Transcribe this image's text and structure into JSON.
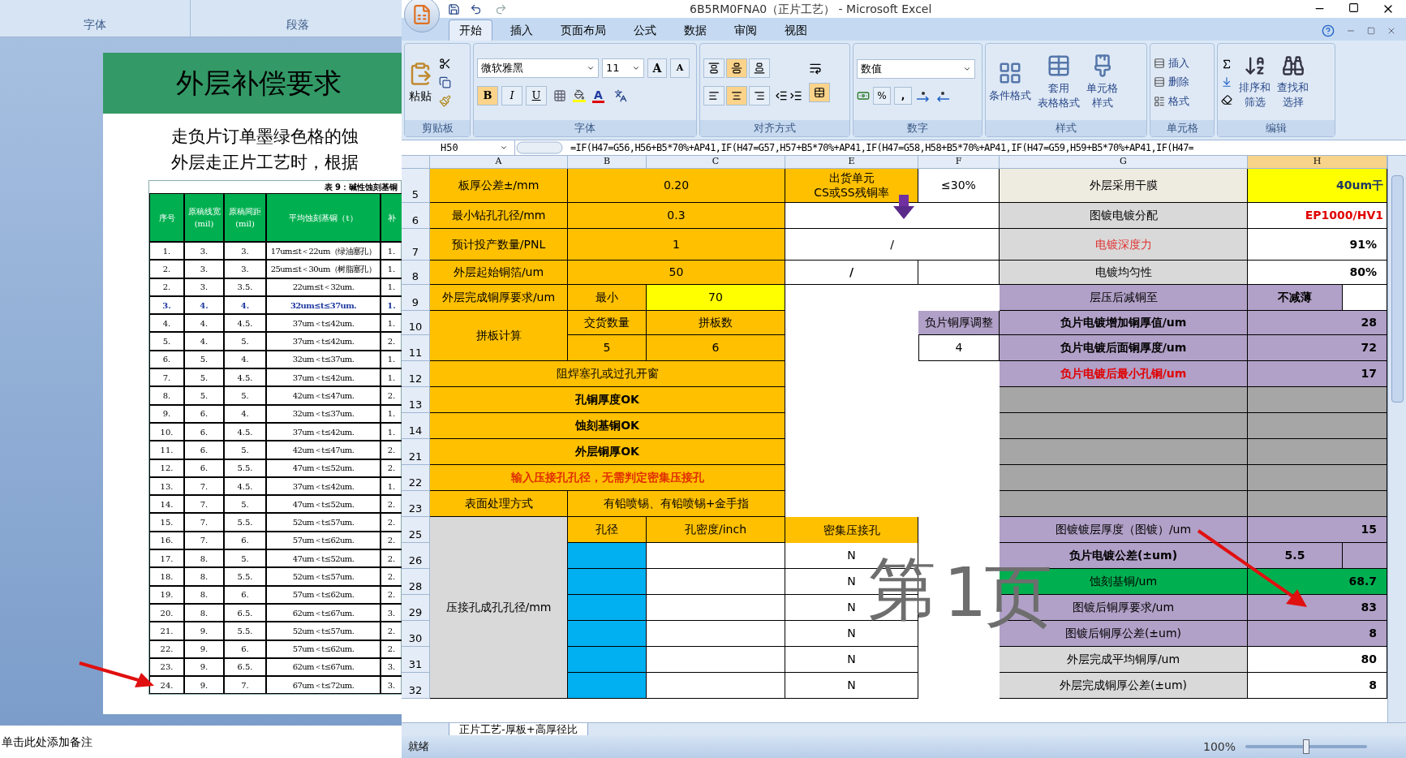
{
  "word": {
    "ribbon_groups": [
      "字体",
      "段落"
    ],
    "slide": {
      "title": "外层补偿要求",
      "lines": [
        "走负片订单墨绿色格的蚀",
        "外层走正片工艺时，根据"
      ],
      "caption": "表 9：碱性蚀刻基铜",
      "columns": [
        "序号",
        "原稿线宽(mil)",
        "原稿间距(mil)",
        "平均蚀刻基铜（t）",
        "补"
      ],
      "rows": [
        {
          "cells": [
            "1.",
            "3.",
            "3.",
            "17um≤t＜22um（绿油塞孔）",
            "1."
          ],
          "highlight": false
        },
        {
          "cells": [
            "2.",
            "3.",
            "3.",
            "25um≤t＜30um（树脂塞孔）",
            "1."
          ],
          "highlight": false
        },
        {
          "cells": [
            "2.",
            "3.",
            "3.5.",
            "22um≤t＜32um.",
            "1."
          ],
          "highlight": false
        },
        {
          "cells": [
            "3.",
            "4.",
            "4.",
            "32um≤t≤37um.",
            "1."
          ],
          "highlight": true
        },
        {
          "cells": [
            "4.",
            "4.",
            "4.5.",
            "37um＜t≤42um.",
            "1."
          ],
          "highlight": false
        },
        {
          "cells": [
            "5.",
            "4.",
            "5.",
            "37um＜t≤42um.",
            "2."
          ],
          "highlight": false
        },
        {
          "cells": [
            "6.",
            "5.",
            "4.",
            "32um＜t≤37um.",
            "1."
          ],
          "highlight": false
        },
        {
          "cells": [
            "7.",
            "5.",
            "4.5.",
            "37um＜t≤42um.",
            "1."
          ],
          "highlight": false
        },
        {
          "cells": [
            "8.",
            "5.",
            "5.",
            "42um＜t≤47um.",
            "2."
          ],
          "highlight": false
        },
        {
          "cells": [
            "9.",
            "6.",
            "4.",
            "32um＜t≤37um.",
            "1."
          ],
          "highlight": false
        },
        {
          "cells": [
            "10.",
            "6.",
            "4.5.",
            "37um＜t≤42um.",
            "1."
          ],
          "highlight": false
        },
        {
          "cells": [
            "11.",
            "6.",
            "5.",
            "42um＜t≤47um.",
            "2."
          ],
          "highlight": false
        },
        {
          "cells": [
            "12.",
            "6.",
            "5.5.",
            "47um＜t≤52um.",
            "2."
          ],
          "highlight": false
        },
        {
          "cells": [
            "13.",
            "7.",
            "4.5.",
            "37um＜t≤42um.",
            "1."
          ],
          "highlight": false
        },
        {
          "cells": [
            "14.",
            "7.",
            "5.",
            "47um＜t≤52um.",
            "2."
          ],
          "highlight": false
        },
        {
          "cells": [
            "15.",
            "7.",
            "5.5.",
            "52um＜t≤57um.",
            "2."
          ],
          "highlight": false
        },
        {
          "cells": [
            "16.",
            "7.",
            "6.",
            "57um＜t≤62um.",
            "2."
          ],
          "highlight": false
        },
        {
          "cells": [
            "17.",
            "8.",
            "5.",
            "47um＜t≤52um.",
            "2."
          ],
          "highlight": false
        },
        {
          "cells": [
            "18.",
            "8.",
            "5.5.",
            "52um＜t≤57um.",
            "2."
          ],
          "highlight": false
        },
        {
          "cells": [
            "19.",
            "8.",
            "6.",
            "57um＜t≤62um.",
            "2."
          ],
          "highlight": false
        },
        {
          "cells": [
            "20.",
            "8.",
            "6.5.",
            "62um＜t≤67um.",
            "3."
          ],
          "highlight": false
        },
        {
          "cells": [
            "21.",
            "9.",
            "5.5.",
            "52um＜t≤57um.",
            "2."
          ],
          "highlight": false
        },
        {
          "cells": [
            "22.",
            "9.",
            "6.",
            "57um＜t≤62um.",
            "2."
          ],
          "highlight": false
        },
        {
          "cells": [
            "23.",
            "9.",
            "6.5.",
            "62um＜t≤67um.",
            "3."
          ],
          "highlight": false
        },
        {
          "cells": [
            "24.",
            "9.",
            "7.",
            "67um＜t≤72um.",
            "3."
          ],
          "highlight": false
        }
      ]
    },
    "notes_placeholder": "单击此处添加备注"
  },
  "excel": {
    "title": "6B5RM0FNA0（正片工艺） - Microsoft Excel",
    "tabs": [
      {
        "label": "开始",
        "selected": true
      },
      {
        "label": "插入",
        "selected": false
      },
      {
        "label": "页面布局",
        "selected": false
      },
      {
        "label": "公式",
        "selected": false
      },
      {
        "label": "数据",
        "selected": false
      },
      {
        "label": "审阅",
        "selected": false
      },
      {
        "label": "视图",
        "selected": false
      }
    ],
    "ribbon": {
      "clipboard": {
        "label": "剪贴板",
        "paste": "粘贴"
      },
      "font": {
        "label": "字体",
        "name": "微软雅黑",
        "size": "11",
        "grow": "A",
        "shrink": "A",
        "color_button": "A",
        "styles": [
          {
            "label": "B",
            "on": true
          },
          {
            "label": "I",
            "on": false
          },
          {
            "label": "U",
            "on": false
          }
        ]
      },
      "alignment": {
        "label": "对齐方式",
        "vertical": [
          {
            "selected": false
          },
          {
            "selected": true
          },
          {
            "selected": false
          }
        ],
        "horizontal": [
          {
            "selected": false
          },
          {
            "selected": true
          },
          {
            "selected": false
          }
        ],
        "merge_on": true
      },
      "number": {
        "label": "数字",
        "format": "数值",
        "percent": "%",
        "comma": ","
      },
      "styles": {
        "label": "样式",
        "buttons": [
          [
            "条件格式"
          ],
          [
            "套用",
            "表格格式"
          ],
          [
            "单元格",
            "样式"
          ]
        ]
      },
      "cells": {
        "label": "单元格",
        "buttons": [
          "插入",
          "删除",
          "格式"
        ]
      },
      "editing": {
        "label": "编辑",
        "buttons": [
          [
            "排序和",
            "筛选"
          ],
          [
            "查找和",
            "选择"
          ]
        ]
      }
    },
    "name_box": "H50",
    "formula": "=IF(H47=G56,H56+B5*70%+AP41,IF(H47=G57,H57+B5*70%+AP41,IF(H47=G58,H58+B5*70%+AP41,IF(H47=G59,H59+B5*70%+AP41,IF(H47=",
    "columns": [
      {
        "label": "A",
        "selected": false
      },
      {
        "label": "B",
        "selected": false
      },
      {
        "label": "C",
        "selected": false
      },
      {
        "label": "E",
        "selected": false
      },
      {
        "label": "F",
        "selected": false
      },
      {
        "label": "G",
        "selected": false
      },
      {
        "label": "H",
        "selected": true
      }
    ],
    "rows": [
      {
        "number": "5",
        "cells": [
          "板厚公差±/mm",
          "0.20",
          "出货单元\nCS或SS残铜率",
          "≤30%",
          "外层采用干膜",
          "40um干"
        ]
      },
      {
        "number": "6",
        "cells": [
          "最小钻孔孔径/mm",
          "0.3",
          "图镀电镀分配",
          "EP1000/HV1"
        ]
      },
      {
        "number": "7",
        "cells": [
          "预计投产数量/PNL",
          "1",
          "/",
          "电镀深度力",
          "91%"
        ]
      },
      {
        "number": "8",
        "cells": [
          "外层起始铜箔/um",
          "50",
          "/",
          "电镀均匀性",
          "80%"
        ]
      },
      {
        "number": "9",
        "cells": [
          "外层完成铜厚要求/um",
          "最小",
          "70",
          "层压后减铜至",
          "不减薄"
        ]
      },
      {
        "number": "10",
        "cells": [
          "拼板计算",
          "交货数量",
          "拼板数",
          "负片铜厚调整",
          "负片电镀增加铜厚值/um",
          "28"
        ]
      },
      {
        "number": "11",
        "cells": [
          "5",
          "6",
          "4",
          "负片电镀后面铜厚度/um",
          "72"
        ]
      },
      {
        "number": "12",
        "cells": [
          "阻焊塞孔或过孔开窗",
          "负片电镀后最小孔铜/um",
          "17"
        ]
      },
      {
        "number": "13",
        "cells": [
          "孔铜厚度OK"
        ]
      },
      {
        "number": "14",
        "cells": [
          "蚀刻基铜OK"
        ]
      },
      {
        "number": "21",
        "cells": [
          "外层铜厚OK"
        ]
      },
      {
        "number": "22",
        "cells": [
          "输入压接孔孔径，无需判定密集压接孔"
        ]
      },
      {
        "number": "23",
        "cells": [
          "表面处理方式",
          "有铅喷锡、有铅喷锡+金手指"
        ]
      },
      {
        "number": "25",
        "cells": [
          "孔径",
          "孔密度/inch",
          "密集压接孔",
          "图镀镀层厚度（图镀）/um",
          "15"
        ]
      },
      {
        "number": "26",
        "cells": [
          "N",
          "负片电镀公差(±um)",
          "5.5"
        ]
      },
      {
        "number": "28",
        "cells": [
          "N",
          "蚀刻基铜/um",
          "68.7"
        ]
      },
      {
        "number": "29",
        "cells": [
          "压接孔成孔孔径/mm",
          "N",
          "图镀后铜厚要求/um",
          "83"
        ]
      },
      {
        "number": "30",
        "cells": [
          "N",
          "图镀后铜厚公差(±um)",
          "8"
        ]
      },
      {
        "number": "31",
        "cells": [
          "N",
          "外层完成平均铜厚/um",
          "80"
        ]
      },
      {
        "number": "32",
        "cells": [
          "N",
          "外层完成铜厚公差(±um)",
          "8"
        ]
      }
    ],
    "page_label": [
      "第",
      "1",
      "页"
    ],
    "sheet_tabs": [
      {
        "label": "正片工艺-厚板+高厚径比",
        "selected": true
      }
    ],
    "status": "就绪",
    "zoom": "100%",
    "zoom_slider": {
      "level": 0.5
    }
  }
}
